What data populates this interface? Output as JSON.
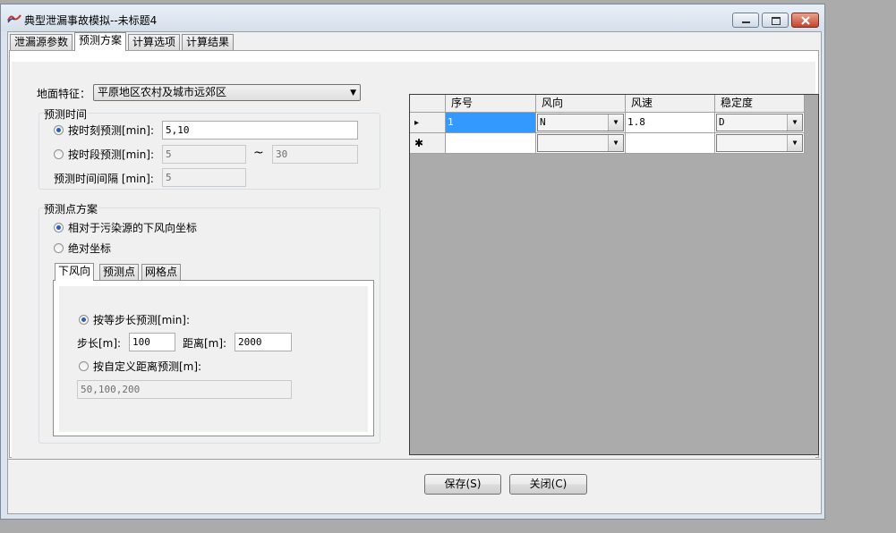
{
  "window": {
    "title": "典型泄漏事故模拟--未标题4",
    "app_icon": "app-logo-icon",
    "controls": {
      "minimize_icon": "minimize-icon",
      "maximize_icon": "maximize-icon",
      "close_icon": "close-icon"
    }
  },
  "tabs": [
    {
      "label": "泄漏源参数"
    },
    {
      "label": "预测方案",
      "active": true
    },
    {
      "label": "计算选项"
    },
    {
      "label": "计算结果"
    }
  ],
  "form": {
    "terrain_label": "地面特征：",
    "terrain_value": "平原地区农村及城市远郊区",
    "forecast_time": {
      "group_label": "预测时间",
      "by_moment_label": "按时刻预测[min]:",
      "by_moment_value": "5,10",
      "by_period_label": "按时段预测[min]:",
      "period_start": "5",
      "period_sep": "~",
      "period_end": "30",
      "interval_label": "预测时间间隔 [min]:",
      "interval_value": "5"
    },
    "forecast_points": {
      "group_label": "预测点方案",
      "relative_label": "相对于污染源的下风向坐标",
      "absolute_label": "绝对坐标",
      "subtabs": [
        "下风向",
        "预测点",
        "网格点"
      ],
      "equal_step_label": "按等步长预测[min]:",
      "step_label": "步长[m]:",
      "step_value": "100",
      "distance_label": "距离[m]:",
      "distance_value": "2000",
      "custom_label": "按自定义距离预测[m]:",
      "custom_value": "50,100,200"
    }
  },
  "grid": {
    "headers": [
      "序号",
      "风向",
      "风速",
      "稳定度"
    ],
    "rows": [
      {
        "indicator": "▸",
        "seq": "1",
        "wind_dir": "N",
        "wind_speed": "1.8",
        "stability": "D"
      },
      {
        "indicator": "✱",
        "seq": "",
        "wind_dir": "",
        "wind_speed": "",
        "stability": ""
      }
    ],
    "selection_color": "#3399ff"
  },
  "buttons": {
    "save": "保存(S)",
    "close": "关闭(C)"
  }
}
